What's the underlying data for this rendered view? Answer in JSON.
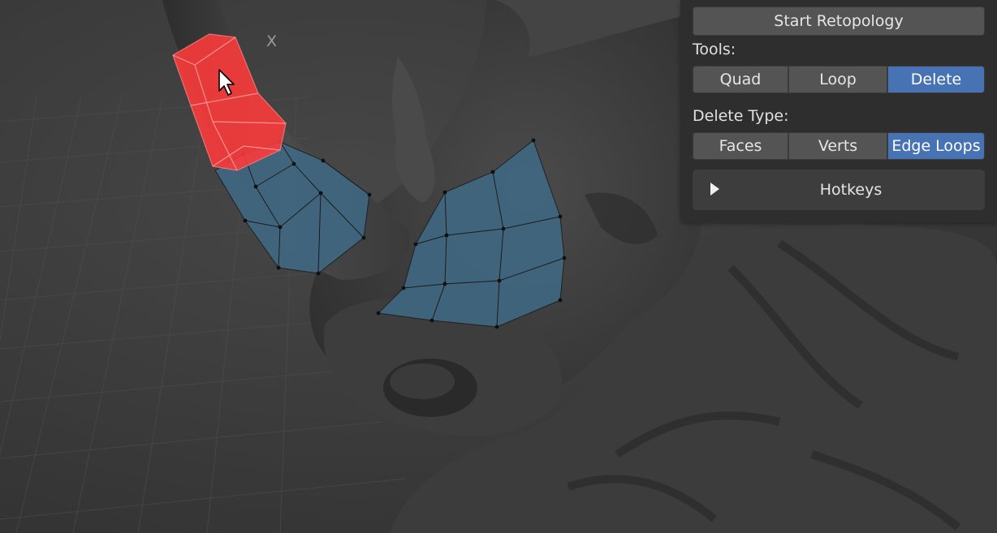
{
  "viewport": {
    "axis_label": "X",
    "cursor_icon": "mouse-pointer-icon"
  },
  "panel": {
    "start_button": "Start Retopology",
    "tools_label": "Tools:",
    "tools": [
      {
        "label": "Quad",
        "active": false
      },
      {
        "label": "Loop",
        "active": false
      },
      {
        "label": "Delete",
        "active": true
      }
    ],
    "delete_type_label": "Delete Type:",
    "delete_types": [
      {
        "label": "Faces",
        "active": false
      },
      {
        "label": "Verts",
        "active": false
      },
      {
        "label": "Edge Loops",
        "active": true
      }
    ],
    "hotkeys_label": "Hotkeys",
    "hotkeys_icon": "disclosure-triangle-right-icon"
  },
  "colors": {
    "accent": "#4772b3",
    "selection": "#ff3b3b",
    "retopo_face": "#3f6a86"
  }
}
